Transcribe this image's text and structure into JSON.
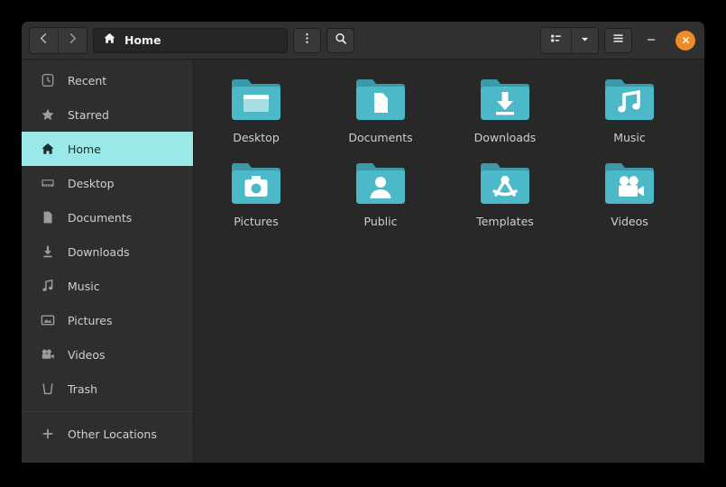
{
  "window": {
    "title": "Home",
    "accent_selection": "#9ae9e9",
    "accent_close": "#ef8b28",
    "folder_color": "#46b6c4"
  },
  "headerbar": {
    "back_icon": "chevron-left-icon",
    "forward_icon": "chevron-right-icon",
    "path_icon": "home-icon",
    "path_label": "Home",
    "menu_icon": "three-dots-vertical-icon",
    "search_icon": "search-icon",
    "view_list_icon": "list-view-icon",
    "view_dropdown_icon": "chevron-down-icon",
    "hamburger_icon": "hamburger-menu-icon",
    "minimize_icon": "minimize-icon",
    "close_icon": "close-icon"
  },
  "sidebar": {
    "items": [
      {
        "label": "Recent",
        "icon": "clock-icon",
        "selected": false
      },
      {
        "label": "Starred",
        "icon": "star-icon",
        "selected": false
      },
      {
        "label": "Home",
        "icon": "home-icon",
        "selected": true
      },
      {
        "label": "Desktop",
        "icon": "desktop-icon",
        "selected": false
      },
      {
        "label": "Documents",
        "icon": "document-icon",
        "selected": false
      },
      {
        "label": "Downloads",
        "icon": "download-icon",
        "selected": false
      },
      {
        "label": "Music",
        "icon": "music-note-icon",
        "selected": false
      },
      {
        "label": "Pictures",
        "icon": "picture-icon",
        "selected": false
      },
      {
        "label": "Videos",
        "icon": "video-camera-icon",
        "selected": false
      },
      {
        "label": "Trash",
        "icon": "trash-icon",
        "selected": false
      }
    ],
    "other_locations": {
      "label": "Other Locations",
      "icon": "plus-icon"
    }
  },
  "content": {
    "items": [
      {
        "label": "Desktop",
        "emblem": "desktop-emblem"
      },
      {
        "label": "Documents",
        "emblem": "document-emblem"
      },
      {
        "label": "Downloads",
        "emblem": "download-emblem"
      },
      {
        "label": "Music",
        "emblem": "music-emblem"
      },
      {
        "label": "Pictures",
        "emblem": "camera-emblem"
      },
      {
        "label": "Public",
        "emblem": "person-emblem"
      },
      {
        "label": "Templates",
        "emblem": "compass-emblem"
      },
      {
        "label": "Videos",
        "emblem": "video-camera-emblem"
      }
    ]
  }
}
